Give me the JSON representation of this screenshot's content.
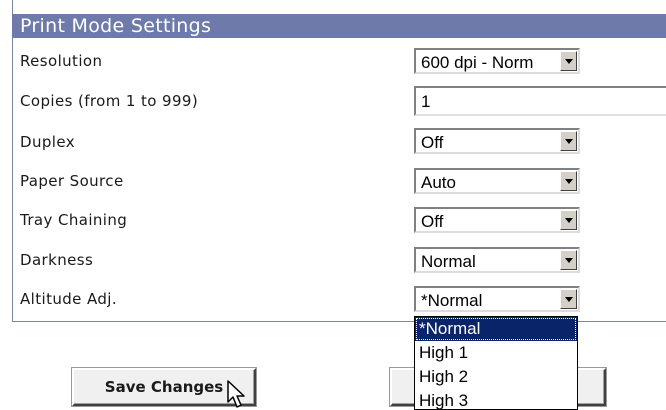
{
  "title": "Print Mode Settings",
  "fields": [
    {
      "label": "Resolution",
      "value": "600 dpi - Norm"
    },
    {
      "label": "Copies (from 1 to 999)",
      "value": "1"
    },
    {
      "label": "Duplex",
      "value": "Off"
    },
    {
      "label": "Paper Source",
      "value": "Auto"
    },
    {
      "label": "Tray Chaining",
      "value": "Off"
    },
    {
      "label": "Darkness",
      "value": "Normal"
    },
    {
      "label": "Altitude Adj.",
      "value": "*Normal"
    }
  ],
  "altitude_options": [
    "*Normal",
    "High 1",
    "High 2",
    "High 3"
  ],
  "altitude_selected": "*Normal",
  "buttons": {
    "save_label": "Save Changes"
  },
  "colors": {
    "header_bg": "#6e7aa9",
    "selection": "#0a246a"
  },
  "icons": {
    "cursor": "arrow-cursor-icon",
    "dropdown": "dropdown-arrow-icon"
  }
}
